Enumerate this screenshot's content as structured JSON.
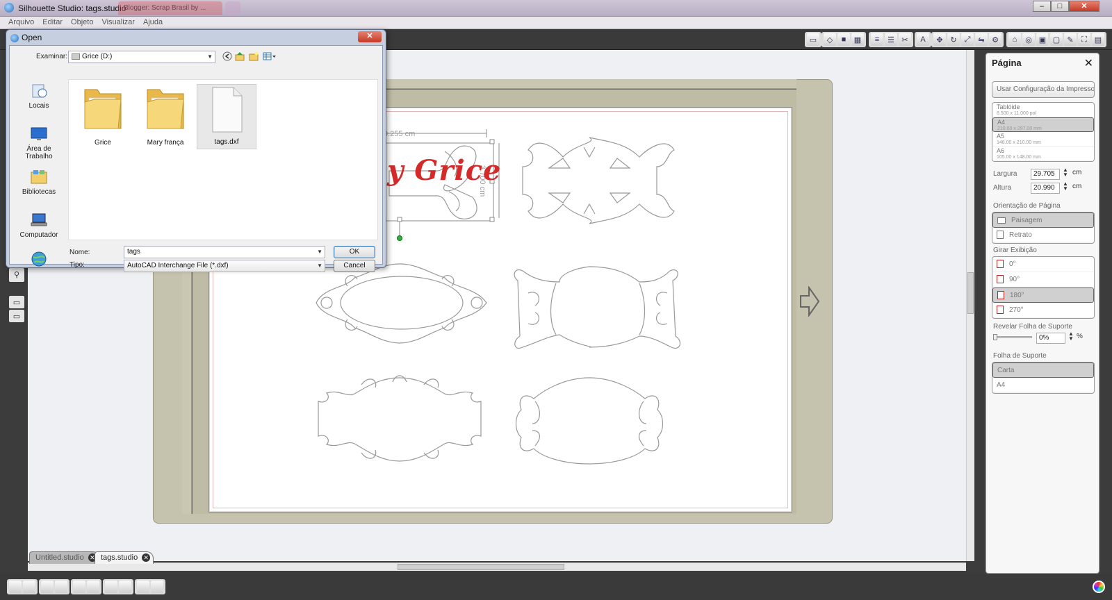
{
  "window": {
    "title": "Silhouette Studio: tags.studio",
    "browser_tab": "Blogger: Scrap Brasil by ...",
    "controls": [
      "–",
      "□",
      "✕"
    ]
  },
  "menu": [
    "Arquivo",
    "Editar",
    "Objeto",
    "Visualizar",
    "Ajuda"
  ],
  "document_tabs": [
    {
      "label": "Untitled.studio",
      "active": false
    },
    {
      "label": "tags.studio",
      "active": true
    }
  ],
  "canvas": {
    "watermark": "Scrap by Grice",
    "width_dimension": "9.255 cm",
    "height_dimension": "3.700 cm"
  },
  "page_panel": {
    "title": "Página",
    "print_settings_button": "Usar Configuração da Impressora",
    "page_sizes": [
      {
        "name": "Tablóide",
        "size": "8.500 x 11.000 pol",
        "selected": false
      },
      {
        "name": "A4",
        "size": "210.00 x 297.00 mm",
        "selected": true
      },
      {
        "name": "A5",
        "size": "148.00 x 210.00 mm",
        "selected": false
      },
      {
        "name": "A6",
        "size": "105.00 x 148.00 mm",
        "selected": false
      }
    ],
    "width_label": "Largura",
    "width_value": "29.705",
    "height_label": "Altura",
    "height_value": "20.990",
    "unit": "cm",
    "orientation_label": "Orientação de Página",
    "orientations": [
      {
        "label": "Paisagem",
        "selected": true
      },
      {
        "label": "Retrato",
        "selected": false
      }
    ],
    "rotate_label": "Girar Exibição",
    "rotations": [
      {
        "label": "0°",
        "selected": false
      },
      {
        "label": "90°",
        "selected": false
      },
      {
        "label": "180°",
        "selected": true
      },
      {
        "label": "270°",
        "selected": false
      }
    ],
    "reveal_label": "Revelar Folha de Suporte",
    "reveal_value": "0%",
    "reveal_unit": "%",
    "carrier_label": "Folha de Suporte",
    "carriers": [
      {
        "label": "Carta",
        "selected": true
      },
      {
        "label": "A4",
        "selected": false
      }
    ]
  },
  "open_dialog": {
    "title": "Open",
    "look_in_label": "Examinar:",
    "look_in_value": "Grice (D:)",
    "places": [
      "Locais",
      "Área de Trabalho",
      "Bibliotecas",
      "Computador"
    ],
    "files": [
      {
        "name": "Grice",
        "type": "folder"
      },
      {
        "name": "Mary frança",
        "type": "folder"
      },
      {
        "name": "tags.dxf",
        "type": "file",
        "selected": true
      }
    ],
    "name_label": "Nome:",
    "name_value": "tags",
    "type_label": "Tipo:",
    "type_value": "AutoCAD Interchange File (*.dxf)",
    "ok_label": "OK",
    "cancel_label": "Cancel"
  },
  "colors": {
    "watermark": "#d42a2a",
    "mat": "#c5c2ad",
    "toolbar": "#3a3a3a",
    "dialog_frame": "#c6cfe0"
  }
}
